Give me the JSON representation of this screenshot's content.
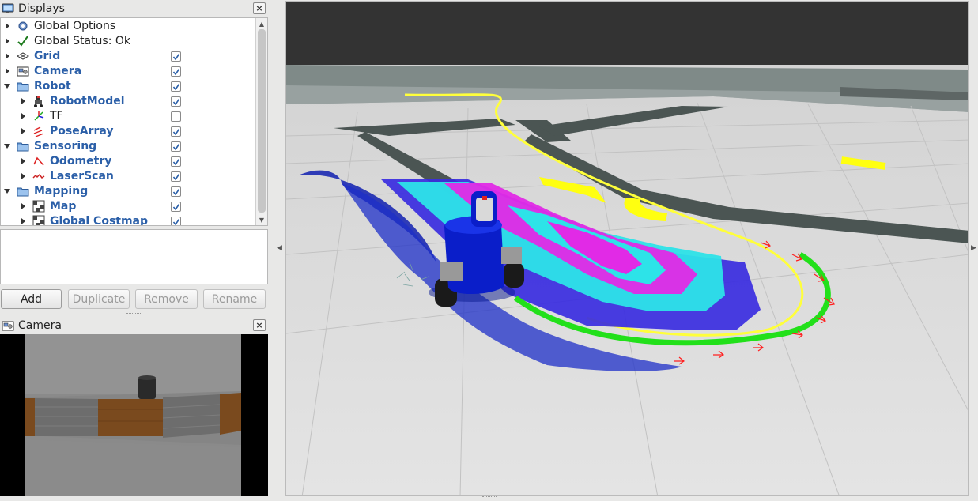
{
  "displays_panel": {
    "title": "Displays",
    "close_label": "×",
    "items": [
      {
        "label": "Global Options",
        "style": "normal",
        "indent": 0,
        "icon": "gear-icon",
        "checkbox": null
      },
      {
        "label": "Global Status: Ok",
        "style": "normal",
        "indent": 0,
        "icon": "checkmark-icon",
        "checkbox": null
      },
      {
        "label": "Grid",
        "style": "blue",
        "indent": 0,
        "icon": "grid-icon",
        "checkbox": true
      },
      {
        "label": "Camera",
        "style": "blue",
        "indent": 0,
        "icon": "camera-icon",
        "checkbox": true
      },
      {
        "label": "Robot",
        "style": "blue",
        "indent": 0,
        "icon": "folder-icon",
        "checkbox": true,
        "expanded": true
      },
      {
        "label": "RobotModel",
        "style": "blue",
        "indent": 1,
        "icon": "robot-model-icon",
        "checkbox": true
      },
      {
        "label": "TF",
        "style": "normal",
        "indent": 1,
        "icon": "tf-icon",
        "checkbox": false
      },
      {
        "label": "PoseArray",
        "style": "blue",
        "indent": 1,
        "icon": "pose-array-icon",
        "checkbox": true
      },
      {
        "label": "Sensoring",
        "style": "blue",
        "indent": 0,
        "icon": "folder-icon",
        "checkbox": true,
        "expanded": true
      },
      {
        "label": "Odometry",
        "style": "blue",
        "indent": 1,
        "icon": "odometry-icon",
        "checkbox": true
      },
      {
        "label": "LaserScan",
        "style": "blue",
        "indent": 1,
        "icon": "laser-scan-icon",
        "checkbox": true
      },
      {
        "label": "Mapping",
        "style": "blue",
        "indent": 0,
        "icon": "folder-icon",
        "checkbox": true,
        "expanded": true
      },
      {
        "label": "Map",
        "style": "blue",
        "indent": 1,
        "icon": "map-icon",
        "checkbox": true
      },
      {
        "label": "Global Costmap",
        "style": "blue",
        "indent": 1,
        "icon": "map-icon",
        "checkbox": true
      }
    ]
  },
  "buttons": {
    "add": "Add",
    "duplicate": "Duplicate",
    "remove": "Remove",
    "rename": "Rename"
  },
  "camera_panel": {
    "title": "Camera",
    "close_label": "×"
  },
  "colors": {
    "item_blue": "#2b5fa8",
    "costmap_cyan": "#2de3e8",
    "costmap_magenta": "#e12ae6",
    "costmap_blue": "#3a2ce0",
    "plan_yellow": "#ffff3a",
    "odom_green": "#22e01a",
    "pose_red": "#ff2020",
    "robot_blue": "#0a1ec9"
  }
}
